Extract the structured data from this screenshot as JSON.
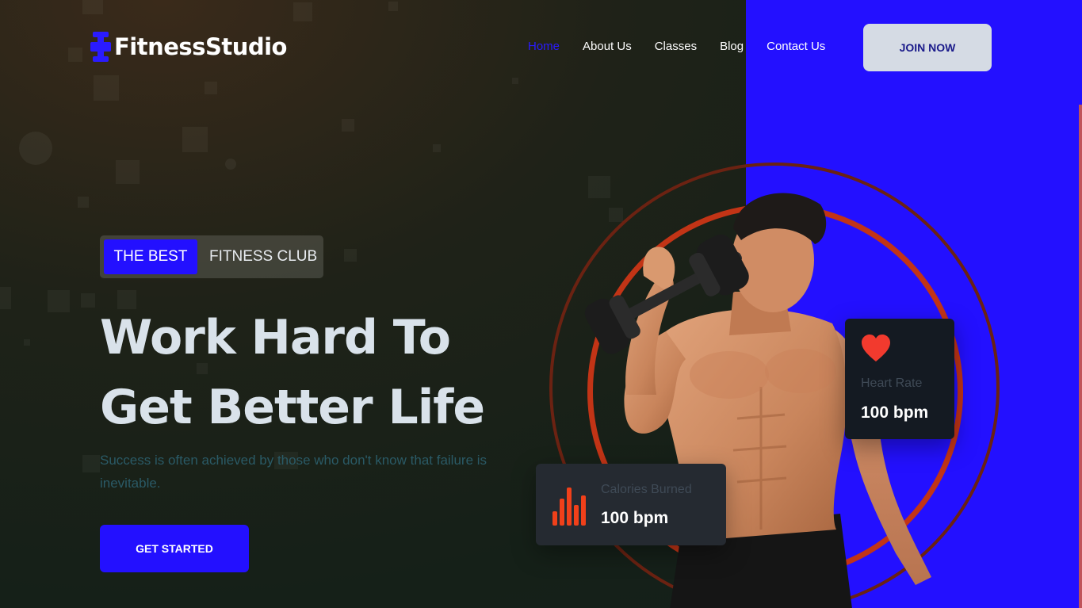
{
  "brand": {
    "name": "FitnessStudio",
    "logo_icon": "dumbbell-icon",
    "accent_color": "#2310ff"
  },
  "nav": {
    "items": [
      {
        "label": "Home",
        "active": true
      },
      {
        "label": "About Us",
        "active": false
      },
      {
        "label": "Classes",
        "active": false
      },
      {
        "label": "Blog",
        "active": false
      },
      {
        "label": "Contact Us",
        "active": false
      }
    ],
    "join_label": "JOIN NOW"
  },
  "hero": {
    "badge_highlight": "THE BEST",
    "badge_rest": "FITNESS CLUB",
    "title_line1": "Work Hard To",
    "title_line2": "Get Better Life",
    "subtitle": "Success is often achieved by those who don't know that failure is inevitable.",
    "cta_label": "GET STARTED"
  },
  "stats": {
    "heart": {
      "label": "Heart Rate",
      "value": "100 bpm",
      "icon": "heart-icon",
      "icon_color": "#f23a2e"
    },
    "calories": {
      "label": "Calories Burned",
      "value": "100 bpm",
      "icon": "bar-chart-icon",
      "icon_color": "#f0401a"
    }
  },
  "images": {
    "athlete": "athlete-with-dumbbell-photo"
  }
}
